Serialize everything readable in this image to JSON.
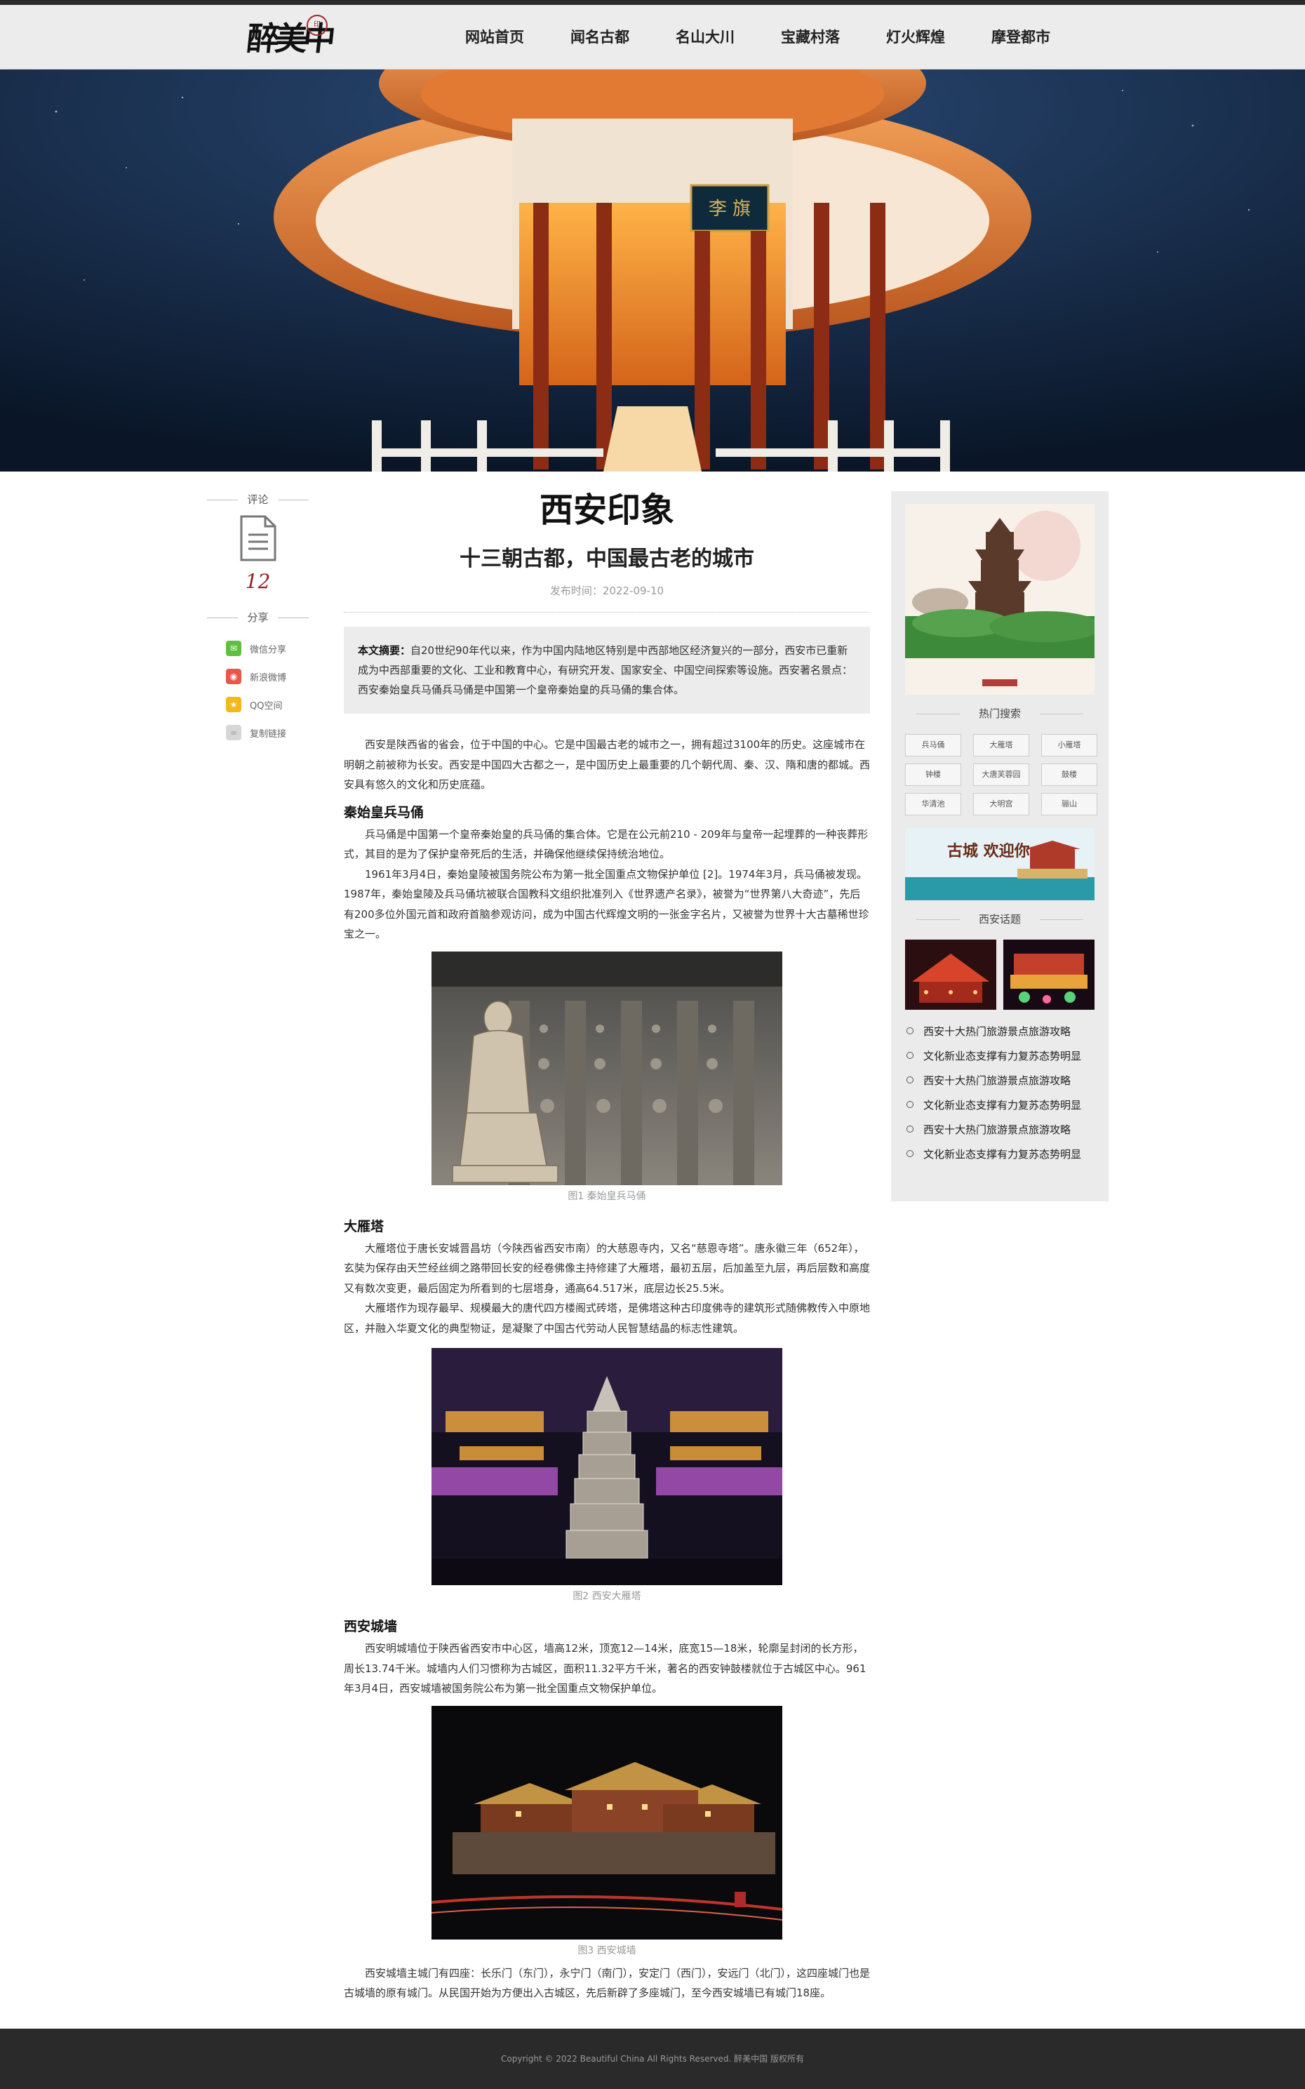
{
  "nav": {
    "items": [
      "网站首页",
      "闻名古都",
      "名山大川",
      "宝藏村落",
      "灯火辉煌",
      "摩登都市"
    ]
  },
  "hero": {
    "sign_text": "李 旗"
  },
  "rail": {
    "comment_label": "评论",
    "comment_count": "12",
    "share_label": "分享",
    "share_items": [
      "微信分享",
      "新浪微博",
      "QQ空间",
      "复制链接"
    ]
  },
  "article": {
    "title": "西安印象",
    "subtitle": "十三朝古都，中国最古老的城市",
    "publish": "发布时间：2022-09-10",
    "summary_label": "本文摘要：",
    "summary_text": "自20世纪90年代以来，作为中国内陆地区特别是中西部地区经济复兴的一部分，西安市已重新成为中西部重要的文化、工业和教育中心，有研究开发、国家安全、中国空间探索等设施。西安著名景点：西安秦始皇兵马俑兵马俑是中国第一个皇帝秦始皇的兵马俑的集合体。",
    "intro": "西安是陕西省的省会，位于中国的中心。它是中国最古老的城市之一，拥有超过3100年的历史。这座城市在明朝之前被称为长安。西安是中国四大古都之一，是中国历史上最重要的几个朝代周、秦、汉、隋和唐的都城。西安具有悠久的文化和历史底蕴。",
    "s1_heading": "秦始皇兵马俑",
    "s1_p1": "兵马俑是中国第一个皇帝秦始皇的兵马俑的集合体。它是在公元前210 - 209年与皇帝一起埋葬的一种丧葬形式，其目的是为了保护皇帝死后的生活，并确保他继续保持统治地位。",
    "s1_p2": "1961年3月4日，秦始皇陵被国务院公布为第一批全国重点文物保护单位 [2]。1974年3月，兵马俑被发现。1987年，秦始皇陵及兵马俑坑被联合国教科文组织批准列入《世界遗产名录》，被誉为“世界第八大奇迹”，先后有200多位外国元首和政府首脑参观访问，成为中国古代辉煌文明的一张金字名片，又被誉为世界十大古墓稀世珍宝之一。",
    "fig1_caption": "图1 秦始皇兵马俑",
    "s2_heading": "大雁塔",
    "s2_p1": "大雁塔位于唐长安城晋昌坊（今陕西省西安市南）的大慈恩寺内，又名“慈恩寺塔”。唐永徽三年（652年），玄奘为保存由天竺经丝绸之路带回长安的经卷佛像主持修建了大雁塔，最初五层，后加盖至九层，再后层数和高度又有数次变更，最后固定为所看到的七层塔身，通高64.517米，底层边长25.5米。",
    "s2_p2": "大雁塔作为现存最早、规模最大的唐代四方楼阁式砖塔，是佛塔这种古印度佛寺的建筑形式随佛教传入中原地区，并融入华夏文化的典型物证，是凝聚了中国古代劳动人民智慧结晶的标志性建筑。",
    "fig2_caption": "图2 西安大雁塔",
    "s3_heading": "西安城墙",
    "s3_p1": "西安明城墙位于陕西省西安市中心区，墙高12米，顶宽12—14米，底宽15—18米，轮廓呈封闭的长方形，周长13.74千米。城墙内人们习惯称为古城区，面积11.32平方千米，著名的西安钟鼓楼就位于古城区中心。961年3月4日，西安城墙被国务院公布为第一批全国重点文物保护单位。",
    "fig3_caption": "图3 西安城墙",
    "s3_p2": "西安城墙主城门有四座：长乐门（东门），永宁门（南门），安定门（西门），安远门（北门），这四座城门也是古城墙的原有城门。从民国开始为方便出入古城区，先后新辟了多座城门，至今西安城墙已有城门18座。"
  },
  "sidebar": {
    "hot_search_label": "热门搜索",
    "tags": [
      "兵马俑",
      "大雁塔",
      "小雁塔",
      "钟楼",
      "大唐芙蓉园",
      "鼓楼",
      "华清池",
      "大明宫",
      "骊山"
    ],
    "banner_text": "古城 欢迎你",
    "topic_label": "西安话题",
    "topics": [
      "西安十大热门旅游景点旅游攻略",
      "文化新业态支撑有力复苏态势明显",
      "西安十大热门旅游景点旅游攻略",
      "文化新业态支撑有力复苏态势明显",
      "西安十大热门旅游景点旅游攻略",
      "文化新业态支撑有力复苏态势明显"
    ]
  },
  "footer": {
    "text": "Copyright © 2022 Beautiful China All Rights Reserved. 醉美中国 版权所有"
  }
}
